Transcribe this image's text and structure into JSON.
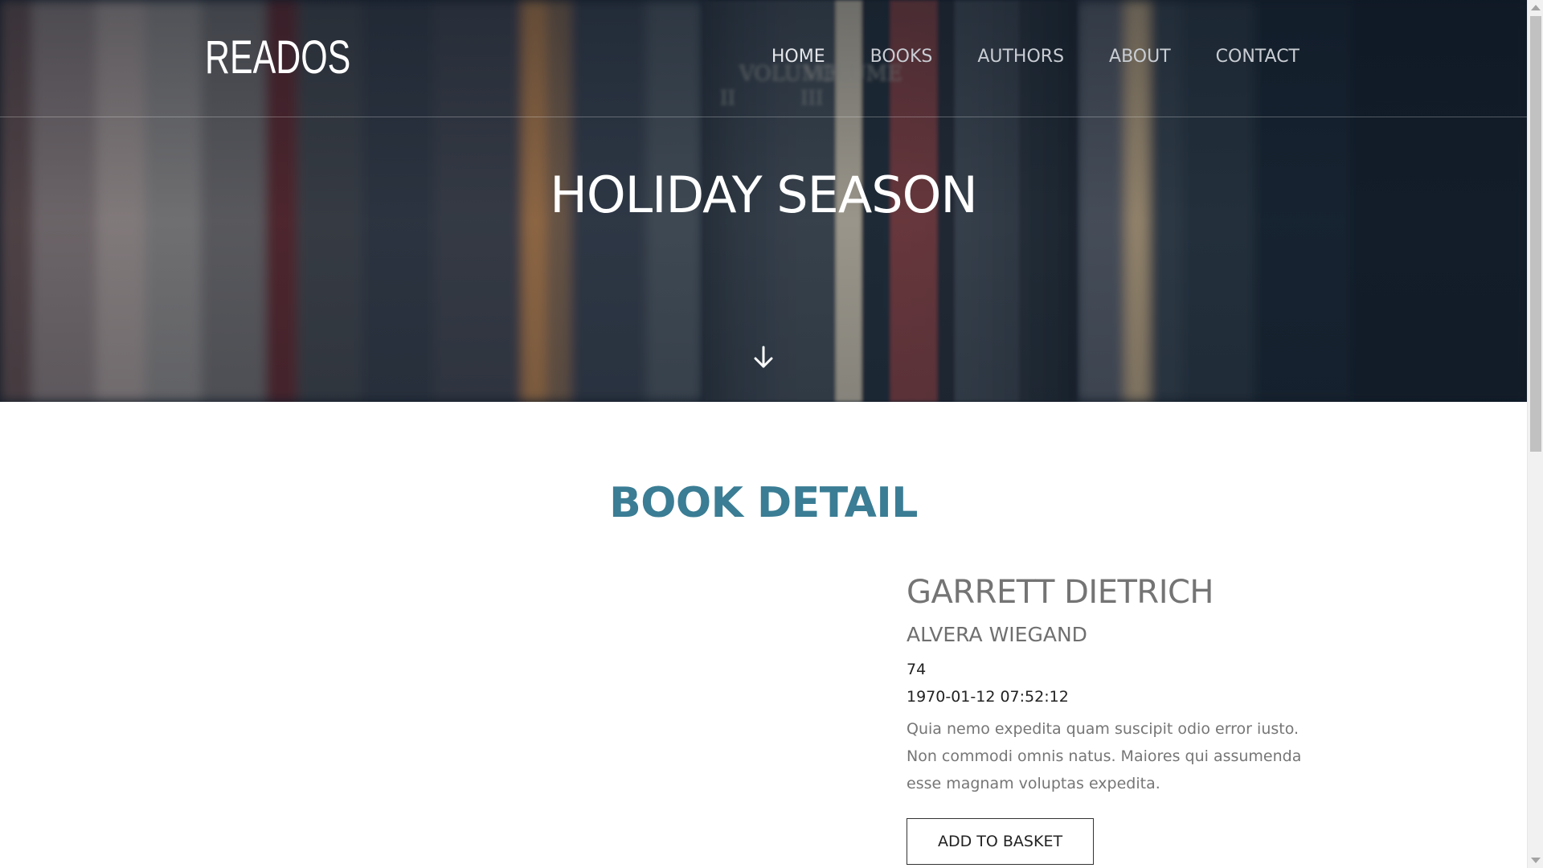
{
  "brand": {
    "logo": "READOS"
  },
  "nav": {
    "items": [
      {
        "label": "HOME"
      },
      {
        "label": "BOOKS"
      },
      {
        "label": "AUTHORS"
      },
      {
        "label": "ABOUT"
      },
      {
        "label": "CONTACT"
      }
    ]
  },
  "hero": {
    "title": "HOLIDAY SEASON",
    "scroll_icon": "arrow-down-icon"
  },
  "section": {
    "title": "BOOK DETAIL"
  },
  "book": {
    "title": "GARRETT DIETRICH",
    "author": "ALVERA WIEGAND",
    "number": "74",
    "date": "1970-01-12 07:52:12",
    "description": "Quia nemo expedita quam suscipit odio error iusto. Non commodi omnis natus. Maiores qui assumenda esse magnam voluptas expedita.",
    "button_label": "ADD TO BASKET"
  },
  "colors": {
    "accent": "#3a7d94",
    "hero_overlay": "#15202e",
    "text_muted": "#767676"
  }
}
